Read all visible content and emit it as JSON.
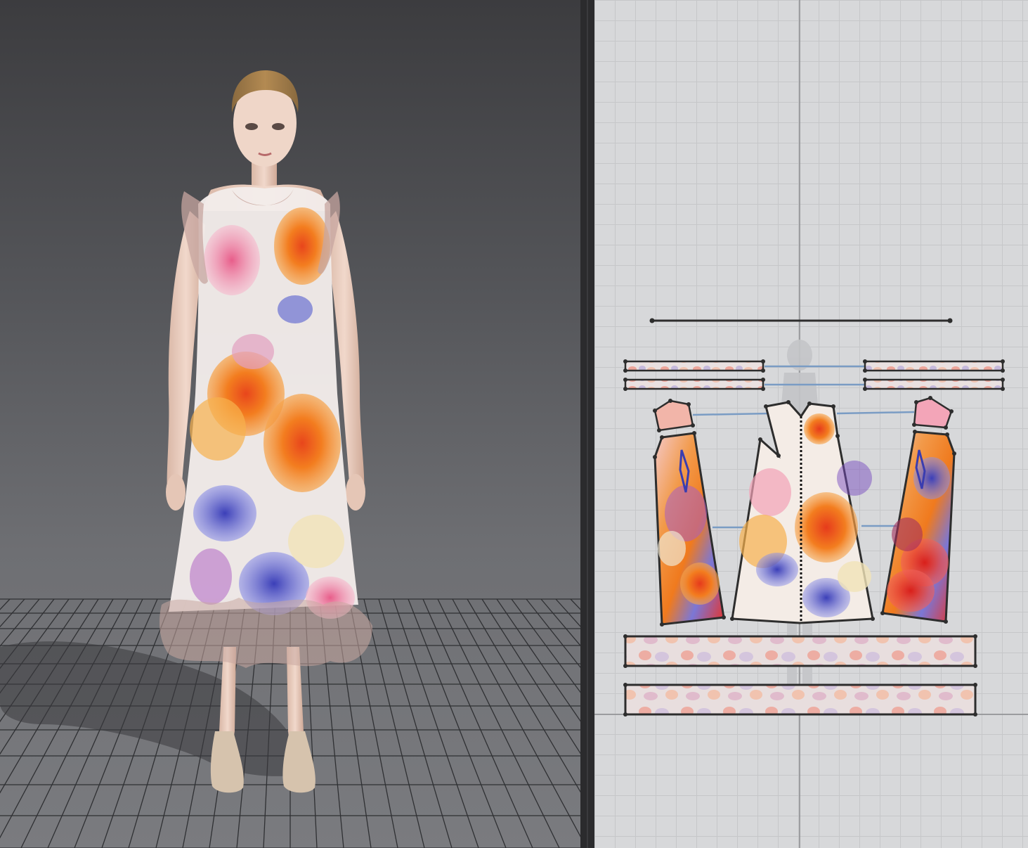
{
  "window": {
    "panels": [
      {
        "id": "3d-view",
        "label": ""
      },
      {
        "id": "2d-pattern-view",
        "label": ""
      }
    ]
  },
  "colors": {
    "viewport_3d_top": "#3c3c3f",
    "viewport_3d_bottom": "#7a7b7f",
    "pattern_bg": "#d7d8da",
    "pattern_grid": "#c6c7c9",
    "pattern_outline": "#2d2d2d",
    "seam_line": "#7a9cc4",
    "print_orange": "#f07a1e",
    "print_pink": "#ee7fa5",
    "print_blue": "#6a6fd6",
    "print_red": "#e8322a"
  },
  "pattern_pieces": [
    {
      "name": "neck-binding"
    },
    {
      "name": "armhole-binding-left-1"
    },
    {
      "name": "armhole-binding-left-2"
    },
    {
      "name": "armhole-binding-right-1"
    },
    {
      "name": "armhole-binding-right-2"
    },
    {
      "name": "yoke-left"
    },
    {
      "name": "yoke-right"
    },
    {
      "name": "side-panel-left"
    },
    {
      "name": "front-panel-center"
    },
    {
      "name": "side-panel-right"
    },
    {
      "name": "hem-ruffle-1"
    },
    {
      "name": "hem-ruffle-2"
    }
  ],
  "icons": [
    "avatar-figure",
    "floor-grid",
    "pattern-grid"
  ]
}
